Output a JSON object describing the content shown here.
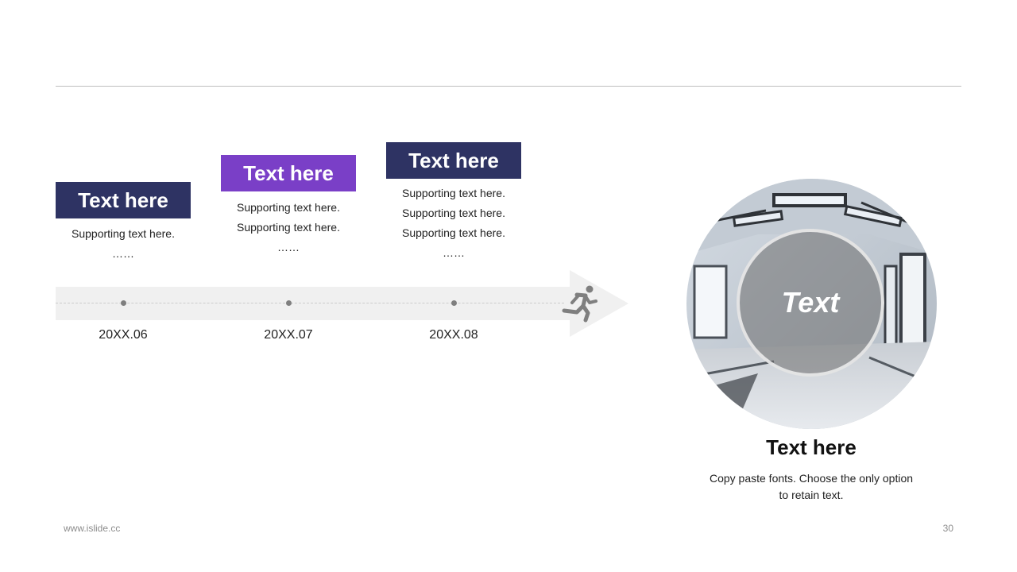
{
  "timeline": {
    "items": [
      {
        "title": "Text here",
        "color": "#2e3363",
        "lines": [
          "Supporting text here.",
          "……"
        ],
        "date": "20XX.06"
      },
      {
        "title": "Text here",
        "color": "#7a3fc7",
        "lines": [
          "Supporting text here.",
          "Supporting text here.",
          "……"
        ],
        "date": "20XX.07"
      },
      {
        "title": "Text here",
        "color": "#2e3363",
        "lines": [
          "Supporting text here.",
          "Supporting text here.",
          "Supporting text here.",
          "……"
        ],
        "date": "20XX.08"
      }
    ],
    "arrow_icon": "running-person-icon"
  },
  "feature": {
    "circle_text": "Text",
    "title": "Text here",
    "description": "Copy paste fonts. Choose the only option to retain text."
  },
  "footer": {
    "url": "www.islide.cc",
    "page": "30"
  }
}
